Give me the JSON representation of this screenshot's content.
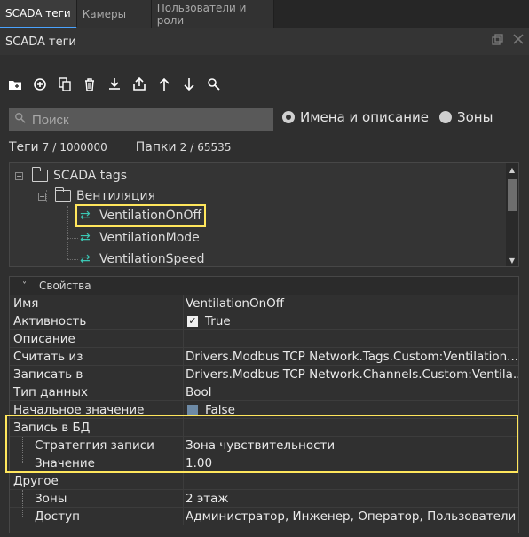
{
  "tabs": [
    "SCADA теги",
    "Камеры",
    "Пользователи и роли"
  ],
  "panel": {
    "title": "SCADA теги",
    "restore_icon": "restore-icon",
    "close_icon": "close-icon"
  },
  "toolbar": {
    "icons": [
      "new-folder-icon",
      "add-icon",
      "copy-icon",
      "delete-icon",
      "import-icon",
      "export-icon",
      "move-up-icon",
      "move-down-icon",
      "search-icon"
    ]
  },
  "search": {
    "placeholder": "Поиск"
  },
  "filter": {
    "option1": "Имена и описание",
    "option2": "Зоны",
    "selected": "Имена и описание"
  },
  "counts": {
    "tags_label": "Теги",
    "tags_value": "7",
    "tags_sep": "/",
    "tags_max": "1000000",
    "folders_label": "Папки",
    "folders_value": "2",
    "folders_sep": "/",
    "folders_max": "65535"
  },
  "tree": {
    "root": "SCADA tags",
    "folder": "Вентиляция",
    "items": [
      "VentilationOnOff",
      "VentilationMode",
      "VentilationSpeed"
    ],
    "selected": "VentilationOnOff"
  },
  "properties": {
    "header": "Свойства",
    "rows": [
      {
        "name": "Имя",
        "value": "VentilationOnOff"
      },
      {
        "name": "Активность",
        "value": "True"
      },
      {
        "name": "Описание",
        "value": ""
      },
      {
        "name": "Считать из",
        "value": "Drivers.Modbus TCP Network.Tags.Custom:Ventilation..."
      },
      {
        "name": "Записать в",
        "value": "Drivers.Modbus TCP Network.Channels.Custom:Ventila..."
      },
      {
        "name": "Тип данных",
        "value": "Bool"
      },
      {
        "name": "Начальное значение",
        "value": "False"
      },
      {
        "name": "Запись в БД",
        "value": ""
      },
      {
        "name": "Стратеггия записи",
        "value": "Зона чувствительности"
      },
      {
        "name": "Значение",
        "value": "1.00"
      },
      {
        "name": "Другое",
        "value": ""
      },
      {
        "name": "Зоны",
        "value": "2 этаж"
      },
      {
        "name": "Доступ",
        "value": "Администратор, Инженер, Оператор, Пользователи"
      }
    ]
  }
}
